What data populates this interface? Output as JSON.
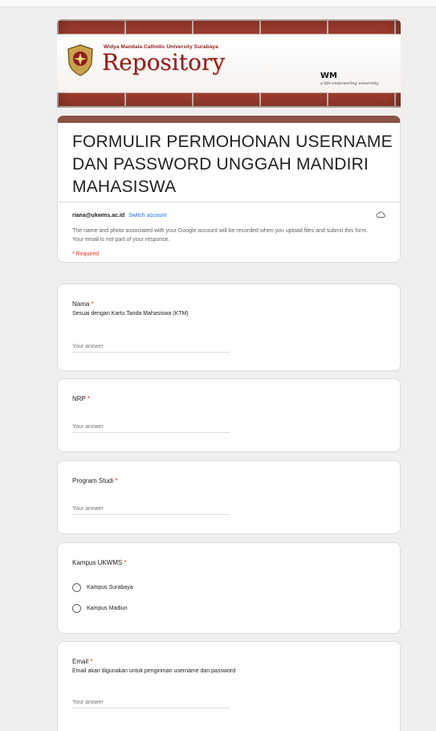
{
  "header": {
    "university_name": "Widya Mandala Catholic University Surabaya",
    "repository_title": "Repository",
    "logo_mark": "WM",
    "logo_tagline": "a life-empowering university",
    "brand_color": "#8e1f1c"
  },
  "form": {
    "title": "FORMULIR PERMOHONAN USERNAME DAN PASSWORD UNGGAH MANDIRI MAHASISWA",
    "account_email": "riana@ukwms.ac.id",
    "switch_account_label": "Switch account",
    "notice": "The name and photo associated with your Google account will be recorded when you upload files and submit this form. Your email is not part of your response.",
    "required_note": "* Required",
    "accent_color": "#8b5246"
  },
  "questions": {
    "nama": {
      "label": "Nama",
      "required_mark": "*",
      "description": "Sesuai dengan Kartu Tanda Mahasiswa (KTM)",
      "placeholder": "Your answer"
    },
    "nrp": {
      "label": "NRP",
      "required_mark": "*",
      "placeholder": "Your answer"
    },
    "program_studi": {
      "label": "Program Studi",
      "required_mark": "*",
      "placeholder": "Your answer"
    },
    "kampus": {
      "label": "Kampus UKWMS",
      "required_mark": "*",
      "options": [
        "Kampus Surabaya",
        "Kampus Madiun"
      ]
    },
    "email": {
      "label": "Email",
      "required_mark": "*",
      "description": "Email akan digunakan untuk pengiriman username dan password",
      "placeholder": "Your answer"
    }
  }
}
